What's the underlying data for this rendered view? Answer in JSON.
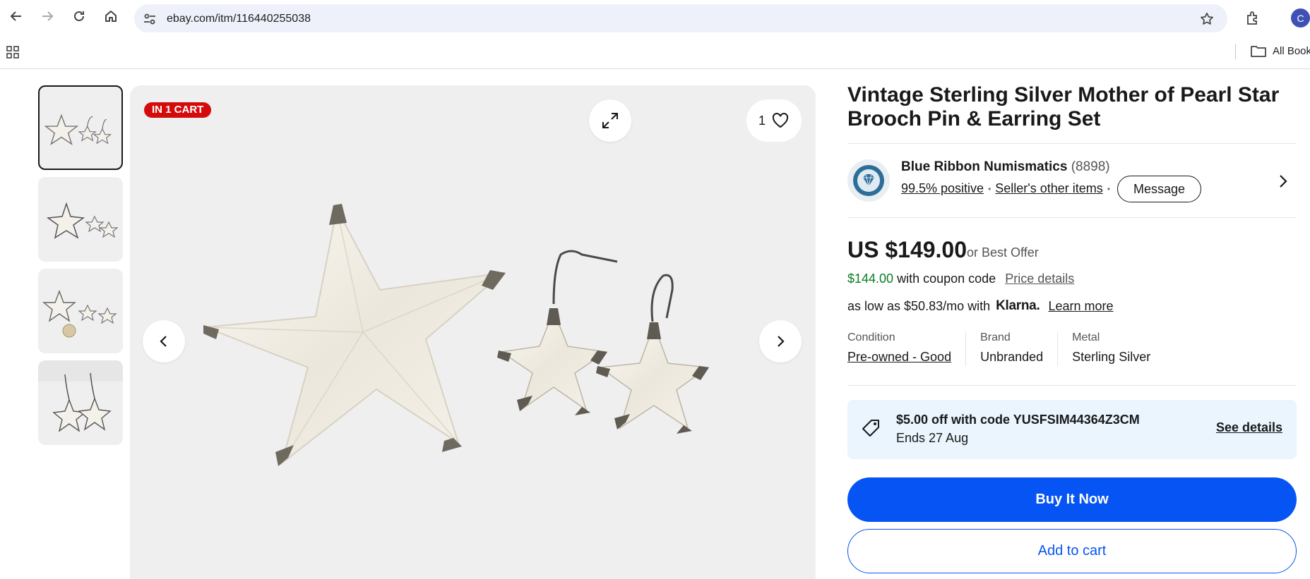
{
  "browser": {
    "url": "ebay.com/itm/116440255038",
    "profile_initial": "C",
    "bookmarks_label": "All Book"
  },
  "gallery": {
    "thumbnails": [
      "thumb-1",
      "thumb-2",
      "thumb-3",
      "thumb-4"
    ],
    "selected_index": 0,
    "badge": "IN 1 CART",
    "watch_count": "1"
  },
  "listing": {
    "title": "Vintage Sterling Silver Mother of Pearl Star Brooch Pin & Earring Set"
  },
  "seller": {
    "name": "Blue Ribbon Numismatics",
    "feedback_count": "(8898)",
    "positive": "99.5% positive",
    "other_items": "Seller's other items",
    "message_label": "Message"
  },
  "pricing": {
    "price": "US $149.00",
    "best_offer": "or Best Offer",
    "coupon_price": "$144.00",
    "coupon_text": "with coupon code",
    "price_details": "Price details",
    "installment_text": "as low as $50.83/mo with",
    "installment_provider": "Klarna.",
    "learn_more": "Learn more"
  },
  "specs": [
    {
      "label": "Condition",
      "value": "Pre-owned - Good"
    },
    {
      "label": "Brand",
      "value": "Unbranded"
    },
    {
      "label": "Metal",
      "value": "Sterling Silver"
    }
  ],
  "promo": {
    "title": "$5.00 off with code YUSFSIM44364Z3CM",
    "subtitle": "Ends 27 Aug",
    "link": "See details"
  },
  "actions": {
    "buy_now": "Buy It Now",
    "add_to_cart": "Add to cart"
  },
  "colors": {
    "accent_blue": "#0654f4",
    "badge_red": "#d50b0b",
    "coupon_green": "#0b7d24",
    "promo_bg": "#eaf5fd"
  }
}
